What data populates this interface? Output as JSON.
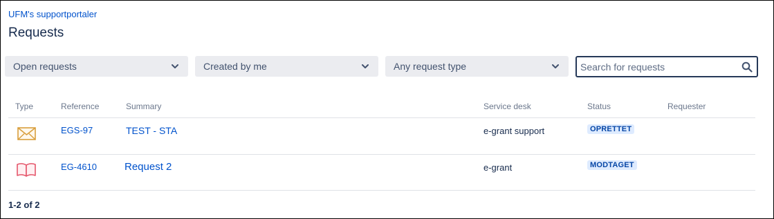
{
  "header": {
    "breadcrumb": "UFM's supportportaler",
    "title": "Requests"
  },
  "filters": {
    "status": "Open requests",
    "owner": "Created by me",
    "request_type": "Any request type",
    "search_placeholder": "Search for requests"
  },
  "table": {
    "columns": [
      "Type",
      "Reference",
      "Summary",
      "Service desk",
      "Status",
      "Requester"
    ],
    "rows": [
      {
        "type_icon": "envelope-icon",
        "reference": "EGS-97",
        "summary": "TEST - STA",
        "service_desk": "e-grant support",
        "status": "OPRETTET",
        "requester": ""
      },
      {
        "type_icon": "book-icon",
        "reference": "EG-4610",
        "summary": "Request 2",
        "service_desk": "e-grant",
        "status": "MODTAGET",
        "requester": ""
      }
    ]
  },
  "pagination": {
    "summary": "1-2 of 2"
  },
  "colors": {
    "link": "#0052cc",
    "badge_bg": "#deebff",
    "badge_text": "#0747a6",
    "envelope": "#d99e3c",
    "book": "#e5566b"
  }
}
